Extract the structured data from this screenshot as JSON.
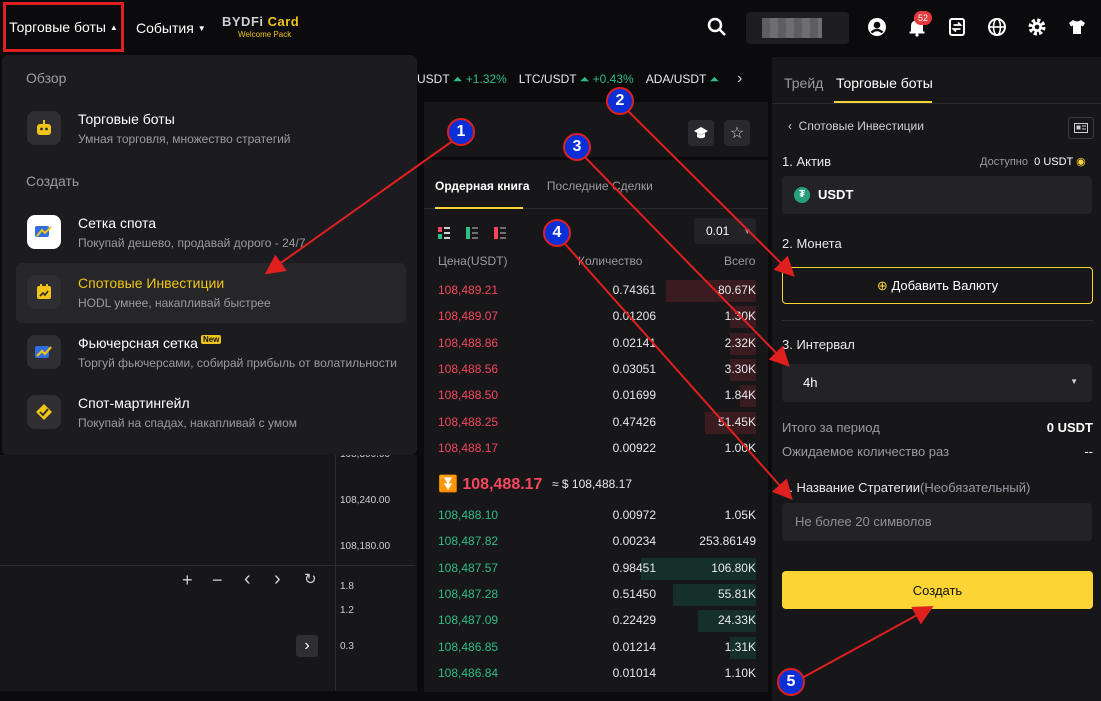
{
  "topbar": {
    "nav_bots": "Торговые боты",
    "nav_events": "События",
    "card_logo_a": "BYDFi",
    "card_logo_b": "Card",
    "card_logo_sub": "Welcome Pack",
    "notif_count": "52"
  },
  "ticker": [
    {
      "pair": "USDT",
      "change": "+1.32%"
    },
    {
      "pair": "LTC/USDT",
      "change": "+0.43%"
    },
    {
      "pair": "ADA/USDT",
      "change": ""
    }
  ],
  "dropdown": {
    "overview": "Обзор",
    "create": "Создать",
    "items": [
      {
        "title": "Торговые боты",
        "sub": "Умная торговля, множество стратегий"
      },
      {
        "title": "Сетка спота",
        "sub": "Покупай дешево, продавай дорого - 24/7"
      },
      {
        "title": "Спотовые Инвестиции",
        "sub": "HODL умнее, накапливай быстрее"
      },
      {
        "title": "Фьючерсная сетка",
        "sub": "Торгуй фьючерсами, собирай прибыль от волатильности",
        "tag": "New"
      },
      {
        "title": "Спот-мартингейл",
        "sub": "Покупай на спадах, накапливай с умом"
      }
    ]
  },
  "chart": {
    "price_labels": [
      "108,300.00",
      "108,240.00",
      "108,180.00"
    ],
    "vol_labels": [
      "1.8",
      "1.2",
      "0.3"
    ]
  },
  "orderbook": {
    "tab_book": "Ордерная книга",
    "tab_trades": "Последние Сделки",
    "precision": "0.01",
    "headers": [
      "Цена(USDT)",
      "Количество",
      "Всего"
    ],
    "asks": [
      {
        "p": "108,489.21",
        "q": "0.74361",
        "t": "80.67K",
        "depth": 0.28
      },
      {
        "p": "108,489.07",
        "q": "0.01206",
        "t": "1.30K",
        "depth": 0.08
      },
      {
        "p": "108,488.86",
        "q": "0.02141",
        "t": "2.32K",
        "depth": 0.08
      },
      {
        "p": "108,488.56",
        "q": "0.03051",
        "t": "3.30K",
        "depth": 0.08
      },
      {
        "p": "108,488.50",
        "q": "0.01699",
        "t": "1.84K",
        "depth": 0.05
      },
      {
        "p": "108,488.25",
        "q": "0.47426",
        "t": "51.45K",
        "depth": 0.16
      },
      {
        "p": "108,488.17",
        "q": "0.00922",
        "t": "1.00K",
        "depth": 0.0
      }
    ],
    "last_price": "108,488.17",
    "last_price_usd": "≈ $ 108,488.17",
    "bids": [
      {
        "p": "108,488.10",
        "q": "0.00972",
        "t": "1.05K",
        "depth": 0.0
      },
      {
        "p": "108,487.82",
        "q": "0.00234",
        "t": "253.86149",
        "depth": 0.0
      },
      {
        "p": "108,487.57",
        "q": "0.98451",
        "t": "106.80K",
        "depth": 0.36
      },
      {
        "p": "108,487.28",
        "q": "0.51450",
        "t": "55.81K",
        "depth": 0.26
      },
      {
        "p": "108,487.09",
        "q": "0.22429",
        "t": "24.33K",
        "depth": 0.18
      },
      {
        "p": "108,486.85",
        "q": "0.01214",
        "t": "1.31K",
        "depth": 0.08
      },
      {
        "p": "108,486.84",
        "q": "0.01014",
        "t": "1.10K",
        "depth": 0.0
      }
    ]
  },
  "right": {
    "tab_trade": "Трейд",
    "tab_bots": "Торговые боты",
    "back_label": "Спотовые Инвестиции",
    "asset_label": "1. Актив",
    "available_label": "Доступно",
    "available_value": "0 USDT",
    "asset_value": "USDT",
    "coin_label": "2. Монета",
    "add_currency": "Добавить Валюту",
    "interval_label": "3. Интервал",
    "interval_value": "4h",
    "period_total_label": "Итого за период",
    "period_total_value": "0 USDT",
    "expected_count_label": "Ожидаемое количество раз",
    "expected_count_value": "--",
    "strategy_label": "4. Название Стратегии",
    "strategy_optional": "(Необязательный)",
    "strategy_placeholder": "Не более 20 символов",
    "create_button": "Создать"
  },
  "callouts": [
    "1",
    "2",
    "3",
    "4",
    "5"
  ],
  "colors": {
    "accent": "#fcd535",
    "up": "#2ebd85",
    "down": "#f6465d",
    "annotation": "#e01f1f",
    "callout_fill": "#0b2fd6"
  }
}
